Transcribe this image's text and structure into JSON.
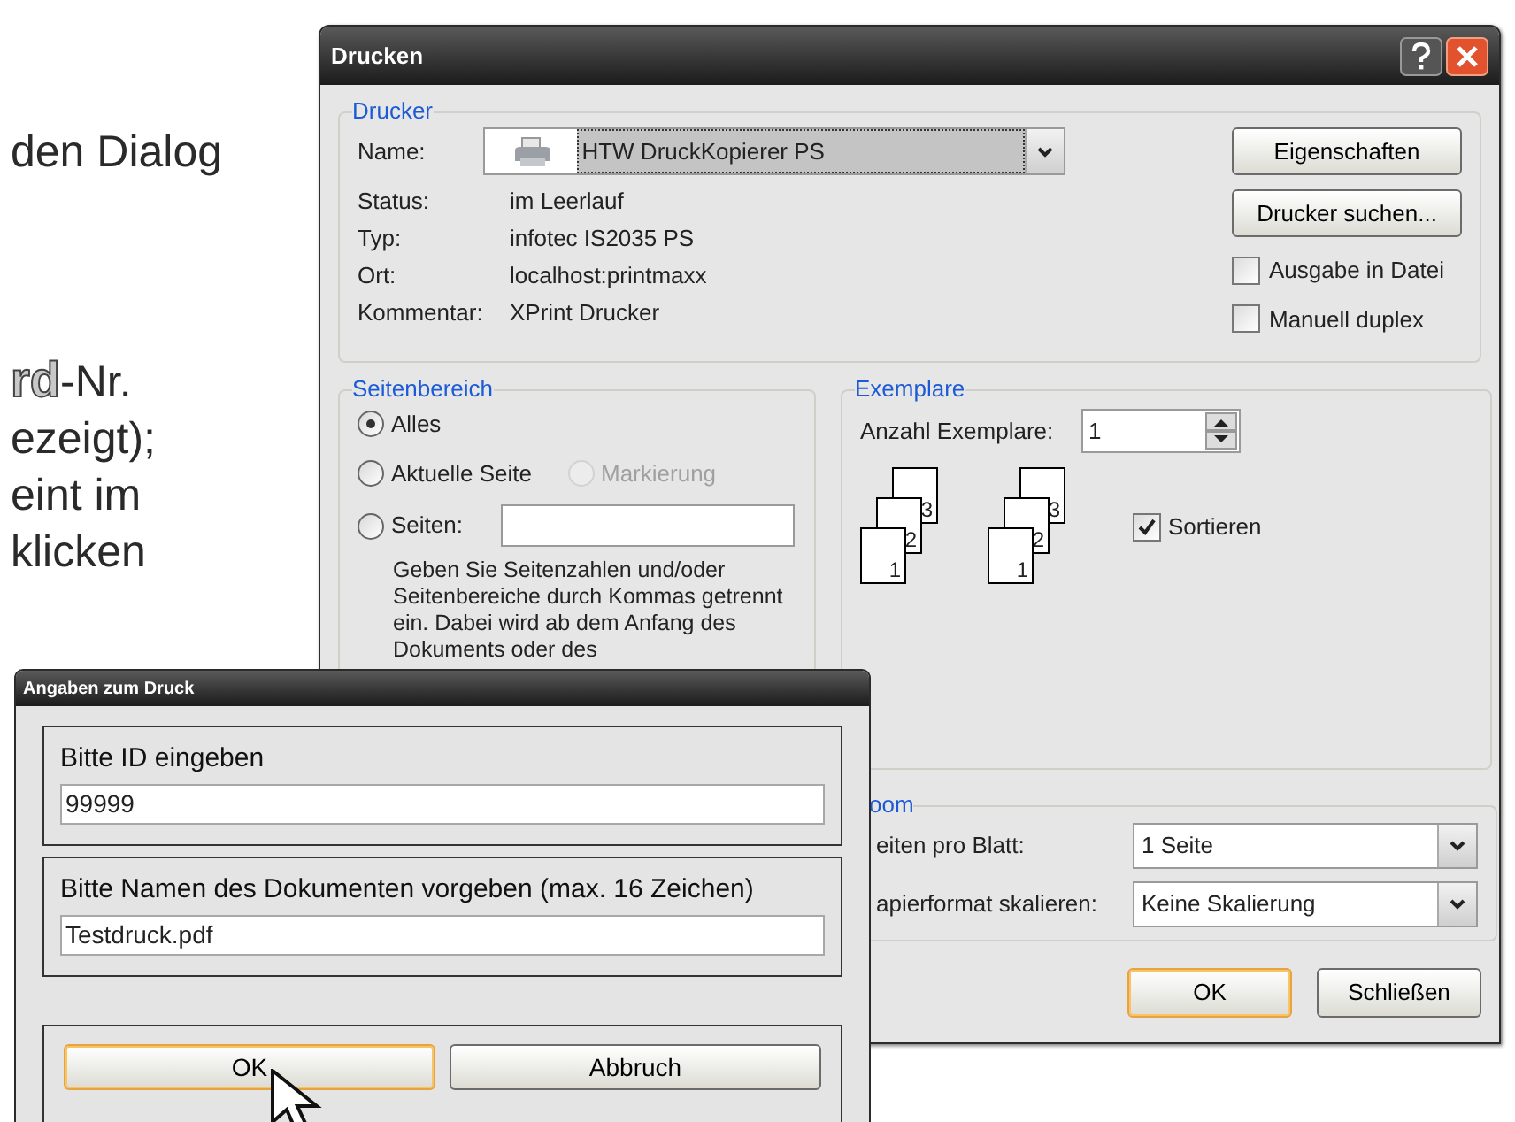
{
  "slide_text": [
    {
      "text": "den Dialog"
    },
    {
      "outlined": "rd",
      "text": "-Nr."
    },
    {
      "text": "ezeigt);"
    },
    {
      "text": "eint im"
    },
    {
      "text": "klicken"
    }
  ],
  "print_dialog": {
    "title": "Drucken",
    "printer": {
      "legend": "Drucker",
      "name_label": {
        "text": "Name:"
      },
      "printer_name": "HTW DruckKopierer PS",
      "fields": [
        {
          "label": "Status:",
          "value": "im Leerlauf"
        },
        {
          "label": "Typ:",
          "value": "infotec  IS2035 PS"
        },
        {
          "label": "Ort:",
          "value": "localhost:printmaxx"
        },
        {
          "label": "Kommentar:",
          "value": "XPrint Drucker"
        }
      ],
      "buttons": [
        {
          "label": "Eigenschaften"
        },
        {
          "label": "Drucker suchen..."
        }
      ],
      "options": [
        {
          "label": "Ausgabe in Datei",
          "checked": false
        },
        {
          "label": "Manuell duplex",
          "checked": false
        }
      ]
    },
    "page_range": {
      "legend": "Seitenbereich",
      "rows": [
        [
          {
            "kind": "radio",
            "label": "Alles",
            "selected": true,
            "disabled": false
          }
        ],
        [
          {
            "kind": "radio",
            "label": "Aktuelle Seite",
            "selected": false,
            "disabled": false
          },
          {
            "kind": "radio",
            "label": "Markierung",
            "selected": false,
            "disabled": true
          }
        ],
        [
          {
            "kind": "radio_field",
            "label": "Seiten:",
            "selected": false,
            "disabled": false
          }
        ]
      ],
      "hint": "Geben Sie Seitenzahlen und/oder Seitenbereiche durch Kommas getrennt ein. Dabei wird ab dem Anfang des Dokuments oder des"
    },
    "copies": {
      "legend": "Exemplare",
      "count_label": {
        "text": "Anzahl Exemplare:"
      },
      "count": "1",
      "stacks": [
        {
          "pages": [
            "3",
            "2",
            "1"
          ]
        },
        {
          "pages": [
            "3",
            "2",
            "1"
          ]
        }
      ],
      "collate": {
        "label": "Sortieren",
        "checked": true
      }
    },
    "zoom": {
      "legend": "oom",
      "rows": [
        {
          "label": "eiten pro Blatt:",
          "value": "1 Seite"
        },
        {
          "label": "apierformat skalieren:",
          "value": "Keine Skalierung"
        }
      ]
    },
    "buttons": [
      {
        "label": "OK",
        "default": true
      },
      {
        "label": "Schließen",
        "default": false
      }
    ]
  },
  "input_dialog": {
    "title": "Angaben zum Druck",
    "fields": [
      {
        "label": "Bitte ID eingeben",
        "value": "99999"
      },
      {
        "label": "Bitte Namen des Dokumenten vorgeben (max. 16 Zeichen)",
        "value": "Testdruck.pdf"
      }
    ],
    "buttons": [
      {
        "label": "OK",
        "default": true
      },
      {
        "label": "Abbruch",
        "default": false
      }
    ]
  }
}
